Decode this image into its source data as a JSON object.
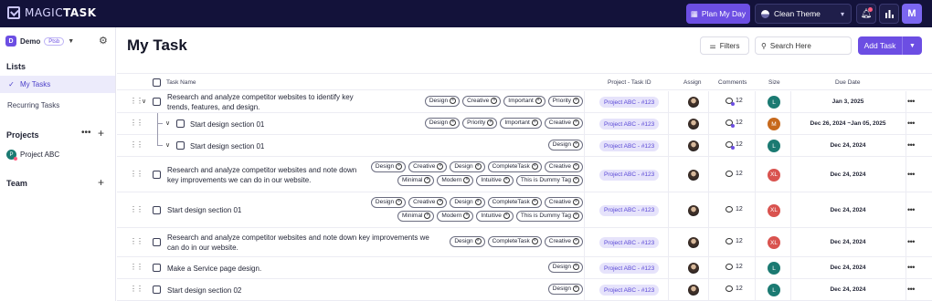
{
  "app": {
    "logo_prefix": "MAGIC",
    "logo_suffix": "TASK",
    "plan_label": "Plan My Day",
    "theme_label": "Clean Theme",
    "user_initial": "M",
    "accent": "#6c4ee3"
  },
  "sidebar": {
    "workspace_initial": "D",
    "workspace_name": "Demo",
    "workspace_pill": "Ptsb",
    "lists_title": "Lists",
    "lists": [
      {
        "label": "My Tasks",
        "active": true
      },
      {
        "label": "Recurring Tasks",
        "active": false
      }
    ],
    "projects_title": "Projects",
    "projects": [
      {
        "initial": "P",
        "label": "Project ABC"
      }
    ],
    "team_title": "Team"
  },
  "header": {
    "title": "My Task",
    "filters_label": "Filters",
    "search_placeholder": "Search Here",
    "add_label": "Add Task"
  },
  "columns": {
    "task_name": "Task Name",
    "project": "Project - Task ID",
    "assign": "Assign",
    "comments": "Comments",
    "size": "Size",
    "due": "Due Date"
  },
  "rows": [
    {
      "name_lines": [
        "Research and analyze competitor websites to identify key",
        "trends, features, and design."
      ],
      "tags": [
        "Design",
        "Creative",
        "Important",
        "Priority"
      ],
      "project": "Project ABC - #123",
      "comments": "12",
      "size": "L",
      "size_color": "#1b7a72",
      "due": "Jan 3, 2025"
    },
    {
      "name_lines": [
        "Start design section 01"
      ],
      "tags": [
        "Design",
        "Priority",
        "Important",
        "Creative"
      ],
      "project": "Project ABC - #123",
      "comments": "12",
      "size": "M",
      "size_color": "#c7691c",
      "due": "Dec 26, 2024 ~Jan 05, 2025"
    },
    {
      "name_lines": [
        "Start design section 01"
      ],
      "tags": [
        "Design"
      ],
      "project": "Project ABC - #123",
      "comments": "12",
      "size": "L",
      "size_color": "#1b7a72",
      "due": "Dec 24, 2024"
    },
    {
      "name_lines": [
        "Research and analyze competitor websites and note down",
        "key improvements we can do in our website."
      ],
      "tags": [
        "Design",
        "Creative",
        "Design",
        "CompleteTask",
        "Creative",
        "Minimal",
        "Modern",
        "Intuitive",
        "This is Dummy Tag"
      ],
      "project": "Project ABC - #123",
      "comments": "12",
      "size": "XL",
      "size_color": "#d9534f",
      "due": "Dec 24, 2024"
    },
    {
      "name_lines": [
        "Start design section 01"
      ],
      "tags": [
        "Design",
        "Creative",
        "Design",
        "CompleteTask",
        "Creative",
        "Minimal",
        "Modern",
        "Intuitive",
        "This is Dummy Tag"
      ],
      "project": "Project ABC - #123",
      "comments": "12",
      "size": "XL",
      "size_color": "#d9534f",
      "due": "Dec 24, 2024"
    },
    {
      "name_lines": [
        "Research and analyze competitor websites and note down key improvements we",
        "can do in our website."
      ],
      "tags": [
        "Design",
        "CompleteTask",
        "Creative"
      ],
      "project": "Project ABC - #123",
      "comments": "12",
      "size": "XL",
      "size_color": "#d9534f",
      "due": "Dec 24, 2024"
    },
    {
      "name_lines": [
        "Make a Service page design."
      ],
      "tags": [
        "Design"
      ],
      "project": "Project ABC - #123",
      "comments": "12",
      "size": "L",
      "size_color": "#1b7a72",
      "due": "Dec 24, 2024"
    },
    {
      "name_lines": [
        "Start design section 02"
      ],
      "tags": [
        "Design"
      ],
      "project": "Project ABC - #123",
      "comments": "12",
      "size": "L",
      "size_color": "#1b7a72",
      "due": "Dec 24, 2024"
    }
  ]
}
